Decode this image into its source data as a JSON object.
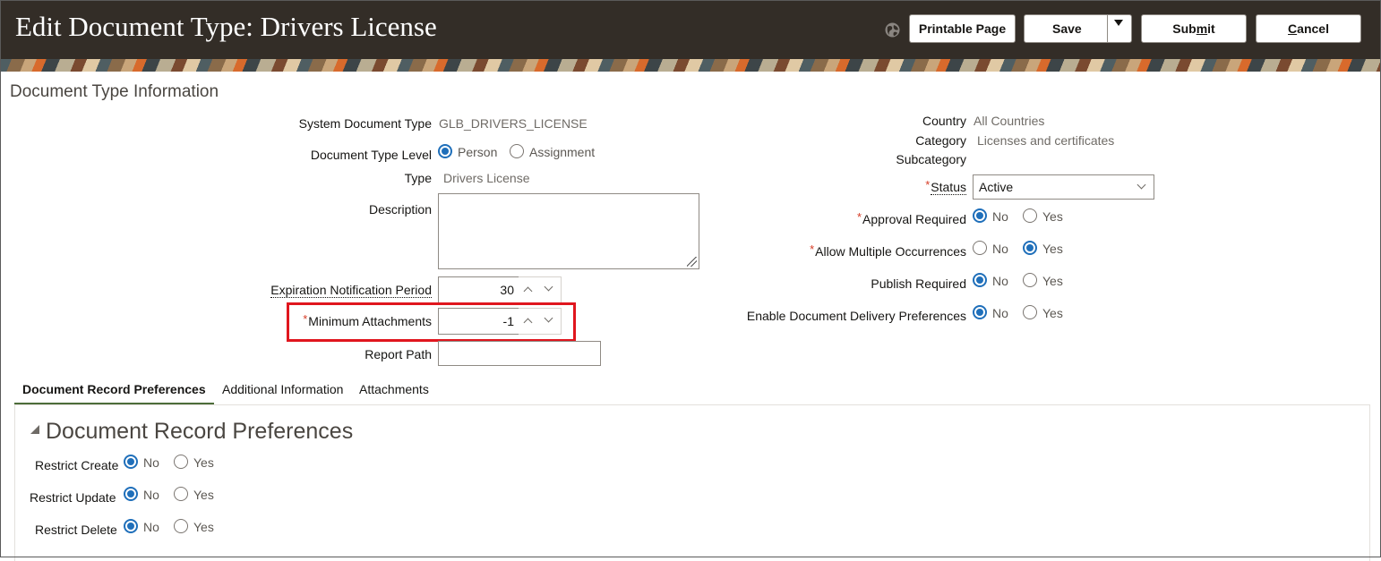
{
  "header": {
    "title": "Edit Document Type: Drivers License",
    "buttons": {
      "printable": "Printable Page",
      "save": "Save",
      "submit_pre": "Sub",
      "submit_u": "m",
      "submit_post": "it",
      "cancel_u": "C",
      "cancel_post": "ancel"
    }
  },
  "section_title": "Document Type Information",
  "left": {
    "system_doc_type": {
      "label": "System Document Type",
      "value": "GLB_DRIVERS_LICENSE"
    },
    "doc_type_level": {
      "label": "Document Type Level",
      "options": [
        "Person",
        "Assignment"
      ],
      "selected": "Person"
    },
    "type": {
      "label": "Type",
      "value": "Drivers License"
    },
    "description": {
      "label": "Description",
      "value": ""
    },
    "expiration": {
      "label": "Expiration Notification Period",
      "value": "30"
    },
    "min_attachments": {
      "label": "Minimum Attachments",
      "required": "*",
      "value": "-1"
    },
    "report_path": {
      "label": "Report Path",
      "value": ""
    }
  },
  "right": {
    "country": {
      "label": "Country",
      "value": "All Countries"
    },
    "category": {
      "label": "Category",
      "value": "Licenses and certificates"
    },
    "subcategory": {
      "label": "Subcategory",
      "value": ""
    },
    "status": {
      "label": "Status",
      "required": "*",
      "value": "Active"
    },
    "approval": {
      "label": "Approval Required",
      "required": "*",
      "selected": "No"
    },
    "multiple": {
      "label": "Allow Multiple Occurrences",
      "required": "*",
      "selected": "Yes"
    },
    "publish": {
      "label": "Publish Required",
      "selected": "No"
    },
    "delivery": {
      "label": "Enable Document Delivery Preferences",
      "selected": "No"
    }
  },
  "yesno": {
    "no": "No",
    "yes": "Yes"
  },
  "tabs": [
    "Document Record Preferences",
    "Additional Information",
    "Attachments"
  ],
  "active_tab": "Document Record Preferences",
  "panel": {
    "title": "Document Record Preferences",
    "restrict_create": {
      "label": "Restrict Create",
      "selected": "No"
    },
    "restrict_update": {
      "label": "Restrict Update",
      "selected": "No"
    },
    "restrict_delete": {
      "label": "Restrict Delete",
      "selected": "No"
    }
  },
  "colors": {
    "header_bg": "#332d27",
    "accent_blue": "#1f6fba",
    "highlight_red": "#e0161e",
    "tab_underline": "#4d6d3a"
  },
  "icons": [
    "globe-icon",
    "chevron-down-icon",
    "chevron-up-icon",
    "collapse-triangle-icon",
    "resize-grip-icon"
  ]
}
